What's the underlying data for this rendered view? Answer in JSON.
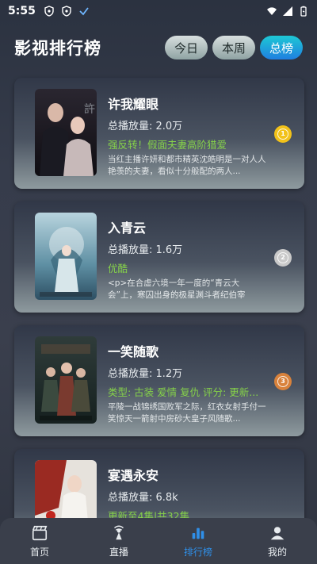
{
  "status_bar": {
    "time": "5:55"
  },
  "header": {
    "title": "影视排行榜",
    "segments": [
      {
        "label": "今日"
      },
      {
        "label": "本周"
      },
      {
        "label": "总榜",
        "active": true
      }
    ]
  },
  "items": [
    {
      "title": "许我耀眼",
      "plays": "总播放量: 2.0万",
      "tags": "强反转！假面夫妻高阶猎爱",
      "desc": "当红主播许妍和都市精英沈皓明是一对人人艳羡的夫妻，看似十分般配的两人...",
      "rank": "1",
      "rank_color": "#f2c21a"
    },
    {
      "title": "入青云",
      "plays": "总播放量: 1.6万",
      "tags": "优酷",
      "desc": "<p>在合虚六境一年一度的“青云大会”上，寒囚出身的极星渊斗者纪伯宰（侯...",
      "rank": "2",
      "rank_color": "#c9c9c9"
    },
    {
      "title": "一笑随歌",
      "plays": "总播放量: 1.2万",
      "tags": "类型: 古装 爱情 复仇  评分:  更新...",
      "desc": "平陵一战锦绣国败军之际，红衣女射手付一笑惊天一箭射中房砂大皇子风随歌...",
      "rank": "3",
      "rank_color": "#d9823c"
    },
    {
      "title": "宴遇永安",
      "plays": "总播放量: 6.8k",
      "tags": "更新至4集|共32集",
      "desc": "",
      "rank": "",
      "rank_color": "#7a8088"
    }
  ],
  "tabbar": {
    "tabs": [
      {
        "label": "首页"
      },
      {
        "label": "直播"
      },
      {
        "label": "排行榜",
        "active": true
      },
      {
        "label": "我的"
      }
    ]
  },
  "colors": {
    "accent": "#2f8fe8",
    "tag_green": "#86d24a"
  }
}
